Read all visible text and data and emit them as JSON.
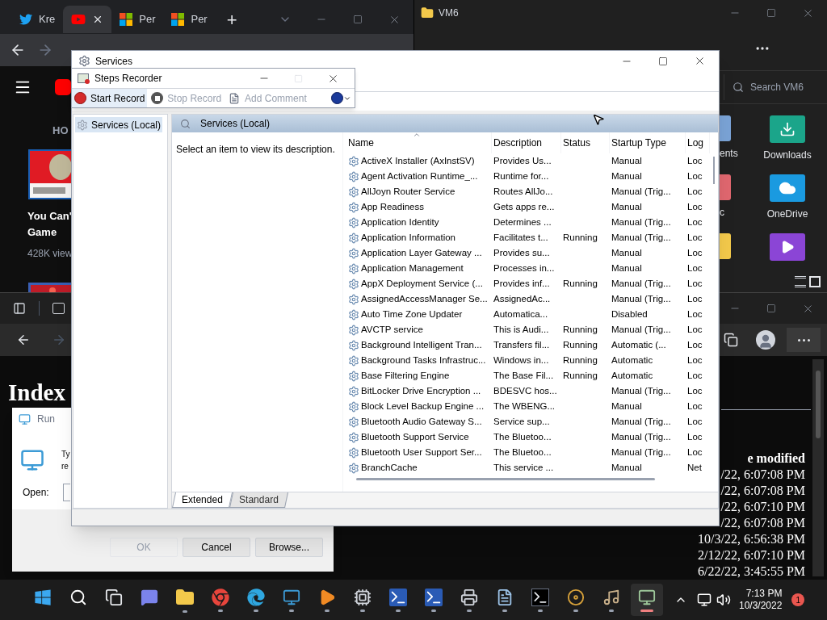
{
  "browser": {
    "tabs": [
      {
        "kind": "bird",
        "label": "Kre",
        "selected": false
      },
      {
        "kind": "video",
        "selected": true
      },
      {
        "kind": "windows",
        "label": "Per",
        "selected": false
      },
      {
        "kind": "windows",
        "label": "Per",
        "selected": false
      }
    ],
    "new_tab": "+",
    "page": {
      "nav_label": "HO",
      "video_title": [
        "You Can'",
        "Game"
      ],
      "views": "428K view"
    }
  },
  "explorer": {
    "title": "VM6",
    "search_placeholder": "Search VM6",
    "items": [
      {
        "kind": "folder",
        "label": "ents"
      },
      {
        "kind": "downloads",
        "label": "Downloads"
      },
      {
        "kind": "music",
        "label": "c"
      },
      {
        "kind": "cloud",
        "label": "OneDrive"
      },
      {
        "kind": "plain"
      },
      {
        "kind": "videos"
      }
    ]
  },
  "edge": {
    "heading": "Index",
    "column_label": "e modified",
    "dates": [
      "/22, 6:07:08 PM",
      "/22, 6:07:08 PM",
      "/22, 6:07:10 PM",
      "/22, 6:07:08 PM",
      "10/3/22, 6:56:38 PM",
      "2/12/22, 6:07:10 PM",
      "6/22/22, 3:45:55 PM"
    ]
  },
  "run_dialog": {
    "title": "Run",
    "prompt_lines": [
      "Ty",
      "re"
    ],
    "open_label": "Open:",
    "buttons": [
      {
        "label": "OK",
        "disabled": true
      },
      {
        "label": "Cancel",
        "disabled": false
      },
      {
        "label": "Browse...",
        "disabled": false
      }
    ]
  },
  "services": {
    "title": "Services",
    "tree": [
      {
        "label": "Services (Local)",
        "selected": true
      }
    ],
    "pane_title": "Services (Local)",
    "description_hint": "Select an item to view its description.",
    "columns": [
      {
        "label": "Name",
        "sorted": true
      },
      {
        "label": "Description",
        "sorted": false
      },
      {
        "label": "Status",
        "sorted": false
      },
      {
        "label": "Startup Type",
        "sorted": false
      },
      {
        "label": "Log",
        "sorted": false
      }
    ],
    "rows": [
      {
        "name": "ActiveX Installer (AxInstSV)",
        "description": "Provides Us...",
        "startup_type": "Manual",
        "log": "Loc"
      },
      {
        "name": "Agent Activation Runtime_...",
        "description": "Runtime for...",
        "startup_type": "Manual",
        "log": "Loc"
      },
      {
        "name": "AllJoyn Router Service",
        "description": "Routes AllJo...",
        "startup_type": "Manual (Trig...",
        "log": "Loc"
      },
      {
        "name": "App Readiness",
        "description": "Gets apps re...",
        "startup_type": "Manual",
        "log": "Loc"
      },
      {
        "name": "Application Identity",
        "description": "Determines ...",
        "startup_type": "Manual (Trig...",
        "log": "Loc"
      },
      {
        "name": "Application Information",
        "description": "Facilitates t...",
        "status": "Running",
        "startup_type": "Manual (Trig...",
        "log": "Loc"
      },
      {
        "name": "Application Layer Gateway ...",
        "description": "Provides su...",
        "startup_type": "Manual",
        "log": "Loc"
      },
      {
        "name": "Application Management",
        "description": "Processes in...",
        "startup_type": "Manual",
        "log": "Loc"
      },
      {
        "name": "AppX Deployment Service (...",
        "description": "Provides inf...",
        "status": "Running",
        "startup_type": "Manual (Trig...",
        "log": "Loc"
      },
      {
        "name": "AssignedAccessManager Se...",
        "description": "AssignedAc...",
        "startup_type": "Manual (Trig...",
        "log": "Loc"
      },
      {
        "name": "Auto Time Zone Updater",
        "description": "Automatica...",
        "startup_type": "Disabled",
        "log": "Loc"
      },
      {
        "name": "AVCTP service",
        "description": "This is Audi...",
        "status": "Running",
        "startup_type": "Manual (Trig...",
        "log": "Loc"
      },
      {
        "name": "Background Intelligent Tran...",
        "description": "Transfers fil...",
        "status": "Running",
        "startup_type": "Automatic (...",
        "log": "Loc"
      },
      {
        "name": "Background Tasks Infrastruc...",
        "description": "Windows in...",
        "status": "Running",
        "startup_type": "Automatic",
        "log": "Loc"
      },
      {
        "name": "Base Filtering Engine",
        "description": "The Base Fil...",
        "status": "Running",
        "startup_type": "Automatic",
        "log": "Loc"
      },
      {
        "name": "BitLocker Drive Encryption ...",
        "description": "BDESVC hos...",
        "startup_type": "Manual (Trig...",
        "log": "Loc"
      },
      {
        "name": "Block Level Backup Engine ...",
        "description": "The WBENG...",
        "startup_type": "Manual",
        "log": "Loc"
      },
      {
        "name": "Bluetooth Audio Gateway S...",
        "description": "Service sup...",
        "startup_type": "Manual (Trig...",
        "log": "Loc"
      },
      {
        "name": "Bluetooth Support Service",
        "description": "The Bluetoo...",
        "startup_type": "Manual (Trig...",
        "log": "Loc"
      },
      {
        "name": "Bluetooth User Support Ser...",
        "description": "The Bluetoo...",
        "startup_type": "Manual (Trig...",
        "log": "Loc"
      },
      {
        "name": "BranchCache",
        "description": "This service ...",
        "startup_type": "Manual",
        "log": "Net"
      }
    ],
    "view_tabs": [
      {
        "label": "Extended",
        "selected": true
      },
      {
        "label": "Standard",
        "selected": false
      }
    ]
  },
  "steps_recorder": {
    "title": "Steps Recorder",
    "buttons": [
      {
        "kind": "record",
        "label": "Start Record",
        "disabled": false
      },
      {
        "kind": "stop",
        "label": "Stop Record",
        "disabled": true
      },
      {
        "kind": "comment",
        "label": "Add Comment",
        "disabled": true
      },
      {
        "kind": "help",
        "disabled": false
      }
    ]
  },
  "taskbar": {
    "apps": [
      {
        "kind": "start",
        "running": false,
        "selected": false
      },
      {
        "kind": "search",
        "running": false,
        "selected": false
      },
      {
        "kind": "taskview",
        "running": false,
        "selected": false
      },
      {
        "kind": "chat",
        "running": false,
        "selected": false
      },
      {
        "kind": "folder",
        "running": true,
        "selected": false
      },
      {
        "kind": "chrome",
        "running": true,
        "selected": false
      },
      {
        "kind": "edge",
        "running": true,
        "selected": false
      },
      {
        "kind": "monitor",
        "running": true,
        "selected": false
      },
      {
        "kind": "media",
        "running": true,
        "selected": false
      },
      {
        "kind": "chip",
        "running": true,
        "selected": false
      },
      {
        "kind": "shell",
        "running": true,
        "selected": false
      },
      {
        "kind": "shell",
        "running": true,
        "selected": false
      },
      {
        "kind": "printer",
        "running": true,
        "selected": false
      },
      {
        "kind": "document",
        "running": true,
        "selected": false
      },
      {
        "kind": "terminal",
        "running": true,
        "selected": false
      },
      {
        "kind": "disc",
        "running": true,
        "selected": false
      },
      {
        "kind": "app",
        "running": true,
        "selected": false
      },
      {
        "kind": "recorder",
        "running": true,
        "selected": true
      }
    ],
    "time": "7:13 PM",
    "date": "10/3/2022",
    "notifications": "1"
  }
}
